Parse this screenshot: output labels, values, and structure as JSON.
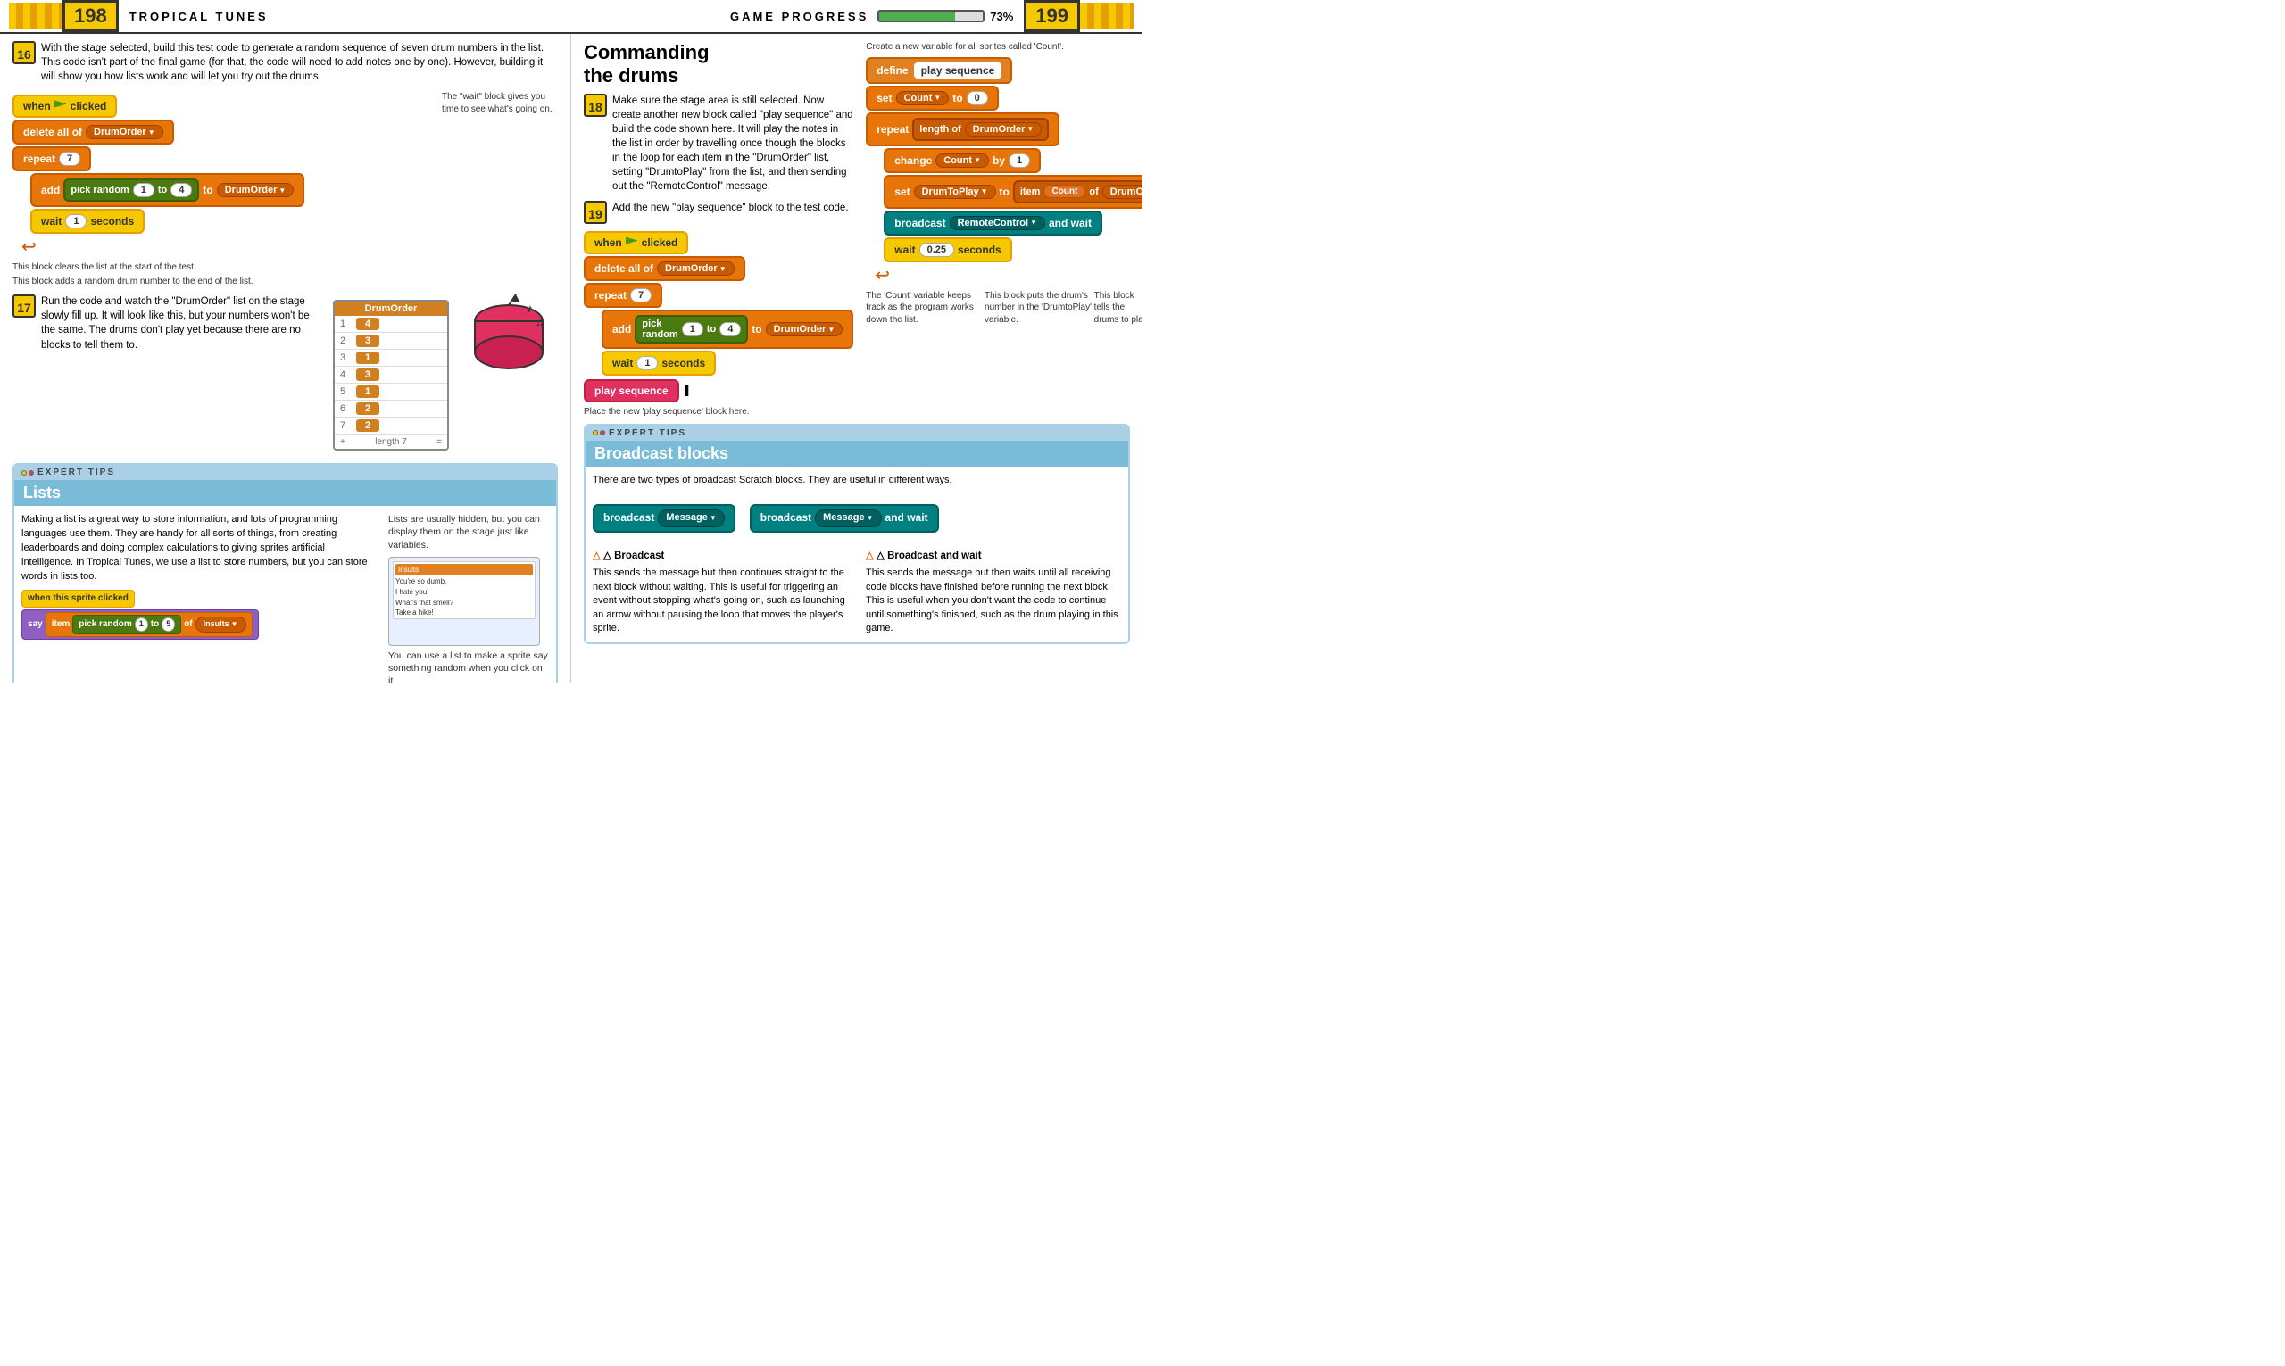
{
  "header": {
    "page_left": "198",
    "title_left": "Tropical Tunes",
    "title_right": "Game Progress",
    "progress_pct": 73,
    "progress_label": "73%",
    "page_right": "199"
  },
  "left": {
    "step16": {
      "number": "16",
      "text": "With the stage selected, build this test code to generate a random sequence of seven drum numbers in the list. This code isn't part of the final game (for that, the code will need to add notes one by one). However, building it will show you how lists work and will let you try out the drums."
    },
    "step17": {
      "number": "17",
      "text": "Run the code and watch the \"DrumOrder\" list on the stage slowly fill up. It will look like this, but your numbers won't be the same. The drums don't play yet because there are no blocks to tell them to."
    },
    "callout1": "This block clears the list at the start of the test.",
    "callout2": "This block adds a random drum number to the end of the list.",
    "callout3": "The \"wait\" block gives you time to see what's going on.",
    "drum_list": {
      "title": "DrumOrder",
      "rows": [
        {
          "num": "1",
          "val": "4"
        },
        {
          "num": "2",
          "val": "3"
        },
        {
          "num": "3",
          "val": "1"
        },
        {
          "num": "4",
          "val": "3"
        },
        {
          "num": "5",
          "val": "1"
        },
        {
          "num": "6",
          "val": "2"
        },
        {
          "num": "7",
          "val": "2"
        }
      ],
      "footer_plus": "+",
      "footer_label": "length 7",
      "footer_equals": "="
    },
    "expert_tips": {
      "header_label": "Expert Tips",
      "title": "Lists",
      "body": "Making a list is a great way to store information, and lots of programming languages use them. They are handy for all sorts of things, from creating leaderboards and doing complex calculations to giving sprites artificial intelligence. In Tropical Tunes, we use a list to store numbers, but you can store words in lists too.",
      "callout": "Lists are usually hidden, but you can display them on the stage just like variables.",
      "callout2": "You can use a list to make a sprite say something random when you click on it.",
      "bottom_block_label": "when this sprite clicked",
      "bottom_say": "say",
      "bottom_item": "item",
      "bottom_pick": "pick random",
      "bottom_1": "1",
      "bottom_to": "to",
      "bottom_5": "5",
      "bottom_of": "of",
      "bottom_insults": "Insults"
    }
  },
  "right": {
    "section_title": "Commanding\nthe drums",
    "step18": {
      "number": "18",
      "text": "Make sure the stage area is still selected. Now create another new block called \"play sequence\" and build the code shown here. It will play the notes in the list in order by travelling once though the blocks in the loop for each item in the \"DrumOrder\" list, setting \"DrumtoPlay\" from the list, and then sending out the \"RemoteControl\" message."
    },
    "step19": {
      "number": "19",
      "text": "Add the new \"play sequence\" block to the test code."
    },
    "callout_count": "Create a new variable for all sprites called 'Count'.",
    "callout_count2": "The 'Count' variable keeps track as the program works down the list.",
    "callout_drum": "This block puts the drum's number in the 'DrumtoPlay' variable.",
    "callout_play": "This block tells the drums to play.",
    "callout_place": "Place the new 'play sequence' block here.",
    "expert_tips2": {
      "header_label": "Expert Tips",
      "title": "Broadcast blocks",
      "body": "There are two types of broadcast Scratch blocks. They are useful in different ways.",
      "broadcast_label": "broadcast",
      "broadcast_wait_label": "broadcast",
      "message": "Message",
      "broadcast_title": "△ Broadcast",
      "broadcast_text": "This sends the message but then continues straight to the next block without waiting. This is useful for triggering an event without stopping what's going on, such as launching an arrow without pausing the loop that moves the player's sprite.",
      "broadcast_wait_title": "△ Broadcast and wait",
      "broadcast_wait_text": "This sends the message but then waits until all receiving code blocks have finished before running the next block. This is useful when you don't want the code to continue until something's finished, such as the drum playing in this game."
    }
  },
  "blocks": {
    "when_clicked": "when",
    "clicked": "clicked",
    "delete_all_of": "delete all of",
    "drum_order_dd": "DrumOrder",
    "repeat": "repeat",
    "seven": "7",
    "add": "add",
    "pick_random": "pick random",
    "one": "1",
    "to": "to",
    "four": "4",
    "drum_order2": "DrumOrder",
    "wait": "wait",
    "wait_val": "1",
    "seconds": "seconds",
    "define": "define",
    "play_sequence": "play sequence",
    "set": "set",
    "count_dd": "Count",
    "to_zero": "0",
    "length_of": "length of",
    "change": "change",
    "count_by": "Count",
    "by_one": "1",
    "set2": "set",
    "drumtoplay": "DrumToPlay",
    "item": "item",
    "count_val": "Count",
    "of": "of",
    "drumorder3": "DrumOrder",
    "broadcast_rc": "RemoteControl",
    "and_wait": "and wait",
    "wait2": "wait",
    "wait2_val": "0.25",
    "play_seq_block": "play sequence"
  }
}
